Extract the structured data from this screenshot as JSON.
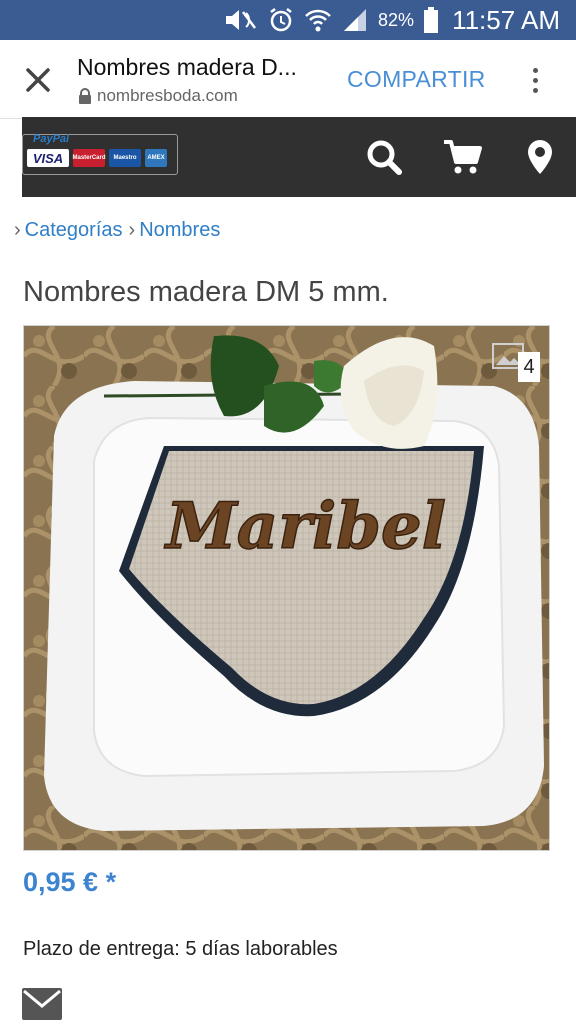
{
  "status_bar": {
    "battery_percent": "82%",
    "time": "11:57 AM",
    "icons": [
      "mute-icon",
      "alarm-icon",
      "wifi-icon",
      "signal-icon",
      "battery-icon"
    ]
  },
  "browser": {
    "title": "Nombres madera D...",
    "url": "nombresboda.com",
    "share_label": "COMPARTIR",
    "icons": [
      "close-icon",
      "lock-icon",
      "more-vertical-icon"
    ]
  },
  "site_header": {
    "payment_label": "PayPal",
    "cards": [
      "VISA",
      "MasterCard",
      "Maestro",
      "AMEX"
    ],
    "icons": [
      "search-icon",
      "cart-icon",
      "location-pin-icon"
    ]
  },
  "breadcrumb": {
    "items": [
      "Categorías",
      "Nombres"
    ]
  },
  "product": {
    "title": "Nombres madera DM 5 mm.",
    "image_word": "Maribel",
    "image_count": "4",
    "price": "0,95 € *",
    "delivery": "Plazo de entrega: 5 días laborables"
  },
  "colors": {
    "status_bar": "#3a5c93",
    "site_header": "#303030",
    "link": "#2f7fc7",
    "price": "#3d84d0"
  }
}
